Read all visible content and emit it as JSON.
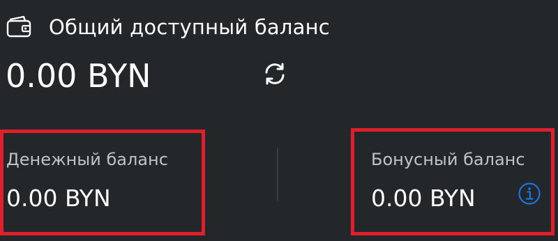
{
  "header": {
    "icon": "wallet-icon",
    "title": "Общий доступный баланс"
  },
  "total": {
    "amount": "0.00 BYN",
    "refresh_icon": "refresh-icon"
  },
  "cash": {
    "label": "Денежный баланс",
    "amount": "0.00 BYN"
  },
  "bonus": {
    "label": "Бонусный баланс",
    "amount": "0.00 BYN",
    "info_icon": "info-icon"
  },
  "colors": {
    "background": "#23272a",
    "highlight_border": "#e01e2c",
    "info_accent": "#1a73e8",
    "label_text": "#bfc3c6"
  }
}
